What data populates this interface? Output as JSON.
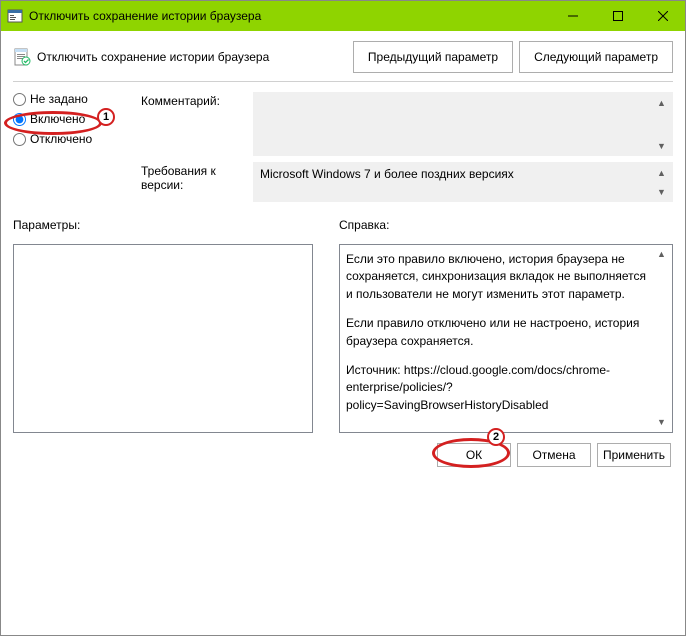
{
  "window": {
    "title": "Отключить сохранение истории браузера"
  },
  "header": {
    "policy_title": "Отключить сохранение истории браузера",
    "prev_button": "Предыдущий параметр",
    "next_button": "Следующий параметр"
  },
  "state": {
    "not_configured": "Не задано",
    "enabled": "Включено",
    "disabled": "Отключено",
    "selected": "enabled"
  },
  "fields": {
    "comment_label": "Комментарий:",
    "requirements_label": "Требования к версии:",
    "requirements_value": "Microsoft Windows 7 и более поздних версиях"
  },
  "lower": {
    "options_label": "Параметры:",
    "help_label": "Справка:",
    "help_p1": "Если это правило включено, история браузера не сохраняется, синхронизация вкладок не выполняется и пользователи не могут изменить этот параметр.",
    "help_p2": "Если правило отключено или не настроено, история браузера сохраняется.",
    "help_p3": "Источник: https://cloud.google.com/docs/chrome-enterprise/policies/?policy=SavingBrowserHistoryDisabled"
  },
  "footer": {
    "ok": "ОК",
    "cancel": "Отмена",
    "apply": "Применить"
  },
  "annotations": {
    "badge1": "1",
    "badge2": "2"
  }
}
